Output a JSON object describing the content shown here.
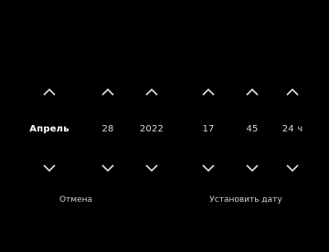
{
  "picker": {
    "month": "Апрель",
    "day": "28",
    "year": "2022",
    "hour": "17",
    "minute": "45",
    "format": "24 ч"
  },
  "actions": {
    "cancel": "Отмена",
    "set_date": "Установить дату"
  },
  "colors": {
    "background": "#000000",
    "text": "#d8d8d8",
    "selected_text": "#ffffff",
    "arrow": "#e0e0e0"
  },
  "icons": {
    "up": "chevron-up-icon",
    "down": "chevron-down-icon"
  }
}
